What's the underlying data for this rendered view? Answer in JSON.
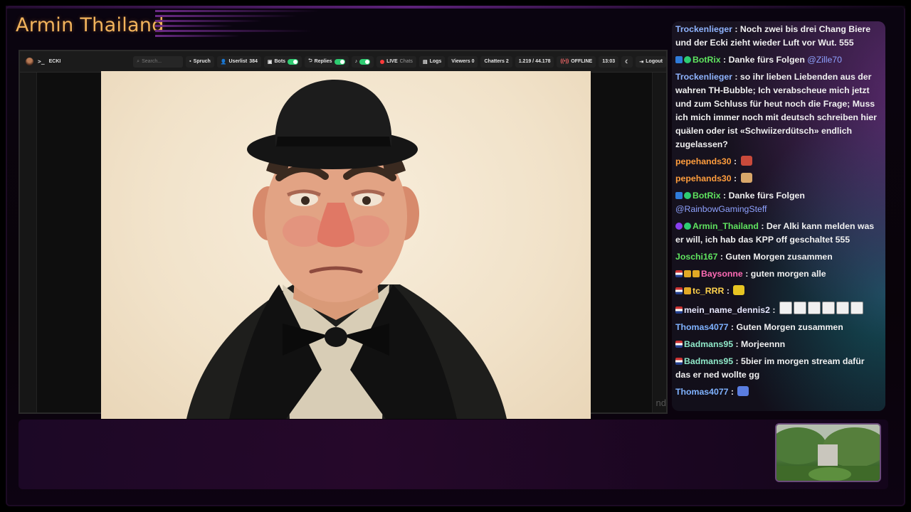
{
  "overlay": {
    "channel_title": "Armin Thailand"
  },
  "toolbar": {
    "channel": "ECKI",
    "search_placeholder": "Search...",
    "spruch": "Spruch",
    "userlist": "Userlist",
    "userlist_count": "384",
    "bots": "Bots",
    "replies": "Replies",
    "live": "LIVE",
    "chats": "Chats",
    "logs": "Logs",
    "viewers": "Viewers 0",
    "chatters": "Chatters 2",
    "counter": "1.219 / 44.178",
    "offline": "OFFLINE",
    "time": "13:03",
    "logout": "Logout"
  },
  "viewport": {
    "end_text": "nd"
  },
  "chat": {
    "messages": [
      {
        "user": "Trockenlieger",
        "user_color": "#8fb4ff",
        "badges": [],
        "text": "Noch zwei bis drei Chang Biere und der Ecki zieht wieder Luft vor Wut. 555",
        "mention": ""
      },
      {
        "user": "BotRix",
        "user_color": "#5fe35f",
        "badges": [
          "blue",
          "check"
        ],
        "text": "Danke fürs Folgen",
        "mention": "@Zille70"
      },
      {
        "user": "Trockenlieger",
        "user_color": "#8fb4ff",
        "badges": [],
        "text": "so ihr lieben Liebenden aus der wahren TH-Bubble; Ich verabscheue mich jetzt und zum Schluss für heut noch die Frage; Muss ich mich immer noch mit deutsch schreiben hier quälen oder ist «Schwiizerdütsch» endlich zugelassen?",
        "mention": ""
      },
      {
        "user": "pepehands30",
        "user_color": "#ff9d3d",
        "badges": [],
        "text": "",
        "mention": "",
        "emote": "red"
      },
      {
        "user": "pepehands30",
        "user_color": "#ff9d3d",
        "badges": [],
        "text": "",
        "mention": "",
        "emote": "hand"
      },
      {
        "user": "BotRix",
        "user_color": "#5fe35f",
        "badges": [
          "blue",
          "check"
        ],
        "text": "Danke fürs Folgen",
        "mention": "@RainbowGamingSteff"
      },
      {
        "user": "Armin_Thailand",
        "user_color": "#5fe35f",
        "badges": [
          "purple",
          "check"
        ],
        "text": "Der Alki kann melden was er will, ich hab das KPP off geschaltet 555",
        "mention": ""
      },
      {
        "user": "Joschi167",
        "user_color": "#5fe35f",
        "badges": [],
        "text": "Guten Morgen zusammen",
        "mention": ""
      },
      {
        "user": "Baysonne",
        "user_color": "#ff6bb5",
        "badges": [
          "flag",
          "gold",
          "gold"
        ],
        "text": "guten morgen alle",
        "mention": ""
      },
      {
        "user": "tc_RRR",
        "user_color": "#ffd24d",
        "badges": [
          "flag",
          "gold"
        ],
        "text": "",
        "mention": "",
        "emote": "yellow"
      },
      {
        "user": "mein_name_dennis2",
        "user_color": "#e8e8ff",
        "badges": [
          "flag"
        ],
        "text": "",
        "mention": "",
        "emote": "boxes"
      },
      {
        "user": "Thomas4077",
        "user_color": "#7fb2ff",
        "badges": [],
        "text": "Guten Morgen zusammen",
        "mention": ""
      },
      {
        "user": "Badmans95",
        "user_color": "#8fe8c8",
        "badges": [
          "flag"
        ],
        "text": "Morjeennn",
        "mention": ""
      },
      {
        "user": "Badmans95",
        "user_color": "#8fe8c8",
        "badges": [
          "flag"
        ],
        "text": "5bier im morgen stream dafür das er ned wollte gg",
        "mention": ""
      },
      {
        "user": "Thomas4077",
        "user_color": "#7fb2ff",
        "badges": [],
        "text": "",
        "mention": "",
        "emote": "blue"
      }
    ]
  }
}
